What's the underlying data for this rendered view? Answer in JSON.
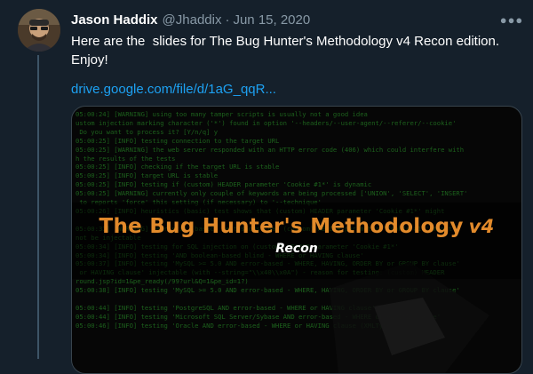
{
  "author": {
    "name": "Jason Haddix",
    "handle": "@Jhaddix",
    "separator": "·",
    "date": "Jun 15, 2020",
    "avatar_icon": "avatar-photo"
  },
  "tweet": {
    "text": "Here are the  slides for The Bug Hunter's Methodology v4 Recon edition. Enjoy!",
    "link_text": "drive.google.com/file/d/1aG_qqR..."
  },
  "more_icon": "ellipsis-icon",
  "media": {
    "title": "The Bug Hunter's Methodology",
    "version": "v4",
    "subtitle": "Recon",
    "terminal_lines": [
      "05:00:24] [WARNING] using too many tamper scripts is usually not a good idea",
      "ustom injection marking character ('*') found in option '--headers/--user-agent/--referer/--cookie'",
      " Do you want to process it? [Y/n/q] y",
      "05:00:25] [INFO] testing connection to the target URL",
      "05:00:25] [WARNING] the web server responded with an HTTP error code (406) which could interfere with",
      "h the results of the tests",
      "05:00:25] [INFO] checking if the target URL is stable",
      "05:00:25] [INFO] target URL is stable",
      "05:00:25] [INFO] testing if (custom) HEADER parameter 'Cookie #1*' is dynamic",
      "05:00:25] [WARNING] currently only couple of keywords are being processed ['UNION', 'SELECT', 'INSERT'",
      " to reports 'force' this setting (if necessary) to '--technique'",
      "05:00:26] [INFO] heuristics (basic) test shows that (custom) HEADER parameter 'Cookie #1*' might",
      "",
      "05:00:31] [WARNING] heuristic (basic) test shows that (custom) HEADER parameter 'Cookie #1*' might",
      "not be injectable",
      "05:00:34] [INFO] testing for SQL injection on (custom) HEADER parameter 'Cookie #1*'",
      "05:00:34] [INFO] testing 'AND boolean-based blind - WHERE or HAVING clause'",
      "05:00:37] [INFO] testing 'MySQL >= 5.0 AND error-based - WHERE, HAVING, ORDER BY or GROUP BY clause'",
      " or HAVING clause' injectable (with --string=\"\\\\x40\\\\x0A\") - reason for testing: (custom) HEADER",
      "round.jsp?id=1&pe_ready(/99?url&Q=1&pe_id=1?)",
      "05:00:38] [INFO] testing 'MySQL >= 5.0 AND error-based - WHERE, HAVING, ORDER BY or GROUP BY clause'",
      "",
      "05:00:44] [INFO] testing 'PostgreSQL AND error-based - WHERE or HAVING clause'",
      "05:00:44] [INFO] testing 'Microsoft SQL Server/Sybase AND error-based - WHERE or HAVING clause'",
      "05:00:46] [INFO] testing 'Oracle AND error-based - WHERE or HAVING clause (XMLType)'"
    ]
  }
}
